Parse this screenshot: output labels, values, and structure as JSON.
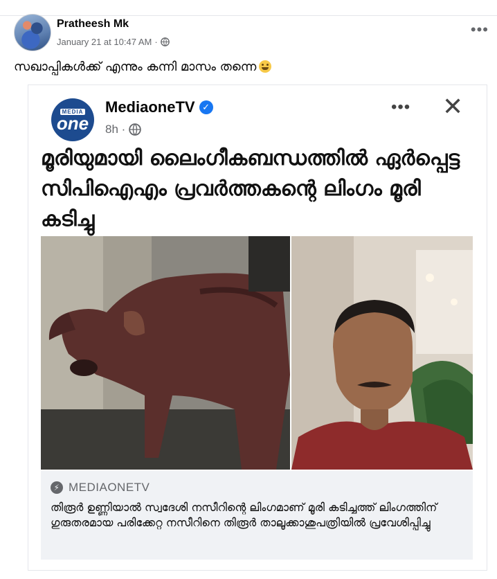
{
  "post": {
    "author": "Pratheesh Mk",
    "timestamp": "January 21 at 10:47 AM",
    "separator": "·",
    "audience_icon": "globe-icon",
    "more_label": "•••",
    "caption": "സഖാപ്പികൾക്ക് എന്നും കന്നി മാസം തന്നെ"
  },
  "shared": {
    "page_name": "MediaoneTV",
    "logo_small": "MEDIA",
    "logo_big": "one",
    "verified_icon": "✓",
    "time": "8h ·",
    "more_label": "•••",
    "close_label": "✕",
    "headline": "മൂരിയുമായി ലൈംഗീകബന്ധത്തിൽ ഏർപ്പെട്ട സിപിഐഎം പ്രവർത്തകന്റെ ലിംഗം മൂരി കടിച്ചു",
    "source_label": "MEDIAONETV",
    "description": "തിരൂർ ഉണ്ണിയാൽ സ്വദേശി നസീറിന്റെ ലിംഗമാണ് മൂരി കടിച്ചത്ത് ലിംഗത്തിന് ഗുരുതരമായ പരിക്കേറ്റ നസീറിനെ തിരൂർ താലൂക്കാശുപത്രിയിൽ പ്രവേശിപ്പിച്ചു"
  },
  "colors": {
    "brand_blue": "#1877f2",
    "mediaone_blue": "#1d4b8f",
    "secondary_text": "#65676b"
  }
}
